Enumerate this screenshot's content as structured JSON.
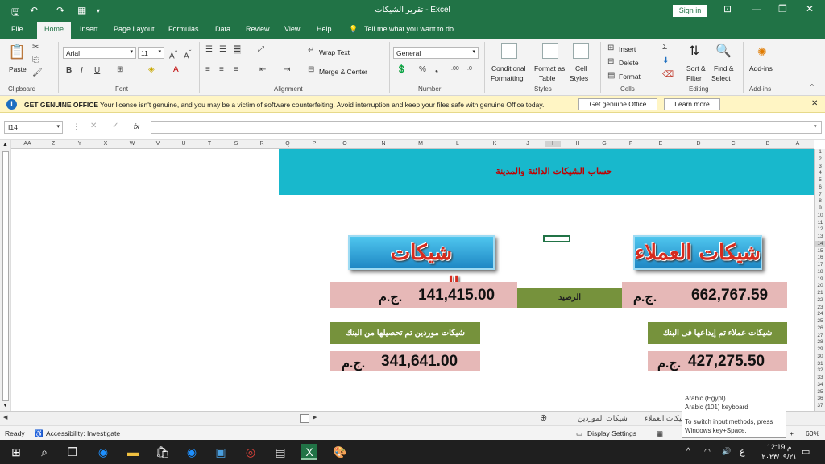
{
  "window": {
    "title": "تقرير الشيكات  -  Excel",
    "sign_in": "Sign in"
  },
  "tabs": [
    "File",
    "Home",
    "Insert",
    "Page Layout",
    "Formulas",
    "Data",
    "Review",
    "View",
    "Help"
  ],
  "tell_me": "Tell me what you want to do",
  "ribbon": {
    "clipboard": {
      "paste": "Paste",
      "group": "Clipboard"
    },
    "font": {
      "name": "Arial",
      "size": "11",
      "group": "Font"
    },
    "alignment": {
      "wrap": "Wrap Text",
      "merge": "Merge & Center",
      "group": "Alignment"
    },
    "number": {
      "format": "General",
      "group": "Number"
    },
    "styles": {
      "conditional_1": "Conditional",
      "conditional_2": "Formatting",
      "format_as_1": "Format as",
      "format_as_2": "Table",
      "cell_1": "Cell",
      "cell_2": "Styles",
      "group": "Styles"
    },
    "cells": {
      "insert": "Insert",
      "delete": "Delete",
      "format": "Format",
      "group": "Cells"
    },
    "editing": {
      "sort_1": "Sort &",
      "sort_2": "Filter",
      "find_1": "Find &",
      "find_2": "Select",
      "group": "Editing"
    },
    "addins": {
      "label": "Add-ins",
      "group": "Add-ins"
    }
  },
  "message_bar": {
    "bold": "GET GENUINE OFFICE",
    "text": "Your license isn't genuine, and you may be a victim of software counterfeiting. Avoid interruption and keep your files safe with genuine Office today.",
    "btn_genuine": "Get genuine Office",
    "btn_learn": "Learn more"
  },
  "formula_bar": {
    "name_box": "I14",
    "fx": "fx",
    "content": ""
  },
  "columns": [
    "AA",
    "Z",
    "Y",
    "X",
    "W",
    "V",
    "U",
    "T",
    "S",
    "R",
    "Q",
    "P",
    "O",
    "N",
    "M",
    "L",
    "K",
    "J",
    "I",
    "H",
    "G",
    "F",
    "E",
    "D",
    "C",
    "B",
    "A"
  ],
  "rows": [
    "1",
    "2",
    "3",
    "4",
    "5",
    "6",
    "7",
    "8",
    "9",
    "10",
    "11",
    "12",
    "13",
    "14",
    "15",
    "16",
    "17",
    "18",
    "19",
    "20",
    "21",
    "22",
    "23",
    "24",
    "25",
    "26",
    "27",
    "28",
    "29",
    "30",
    "31",
    "32",
    "33",
    "34",
    "35",
    "36",
    "37"
  ],
  "sheet": {
    "banner": "حساب الشيكات الدائنة والمدينة",
    "customers_title": "شيكات العملاء",
    "suppliers_title": "شيكات الموردين",
    "balance_label": "الرصيد",
    "customers_amount": "662,767.59",
    "suppliers_amount": "141,415.00",
    "currency": "ج.م.",
    "customers_bank_label": "شيكات عملاء تم إيداعها فى البنك",
    "suppliers_bank_label": "شيكات موردين  تم تحصيلها من البنك",
    "customers_bank_amount": "427,275.50",
    "suppliers_bank_amount": "341,641.00"
  },
  "sheet_tabs": [
    "شيكات العملاء",
    "شيكات الموردين"
  ],
  "status": {
    "ready": "Ready",
    "accessibility": "Accessibility: Investigate",
    "display": "Display Settings",
    "zoom": "60%"
  },
  "tooltip": {
    "line1": "Arabic (Egypt)",
    "line2": "Arabic (101) keyboard",
    "line3": "To switch input methods, press",
    "line4": "Windows key+Space."
  },
  "taskbar": {
    "lang": "ع",
    "time": "12:19 م",
    "date": "٢٠٢٣/٠٩/٢١"
  }
}
